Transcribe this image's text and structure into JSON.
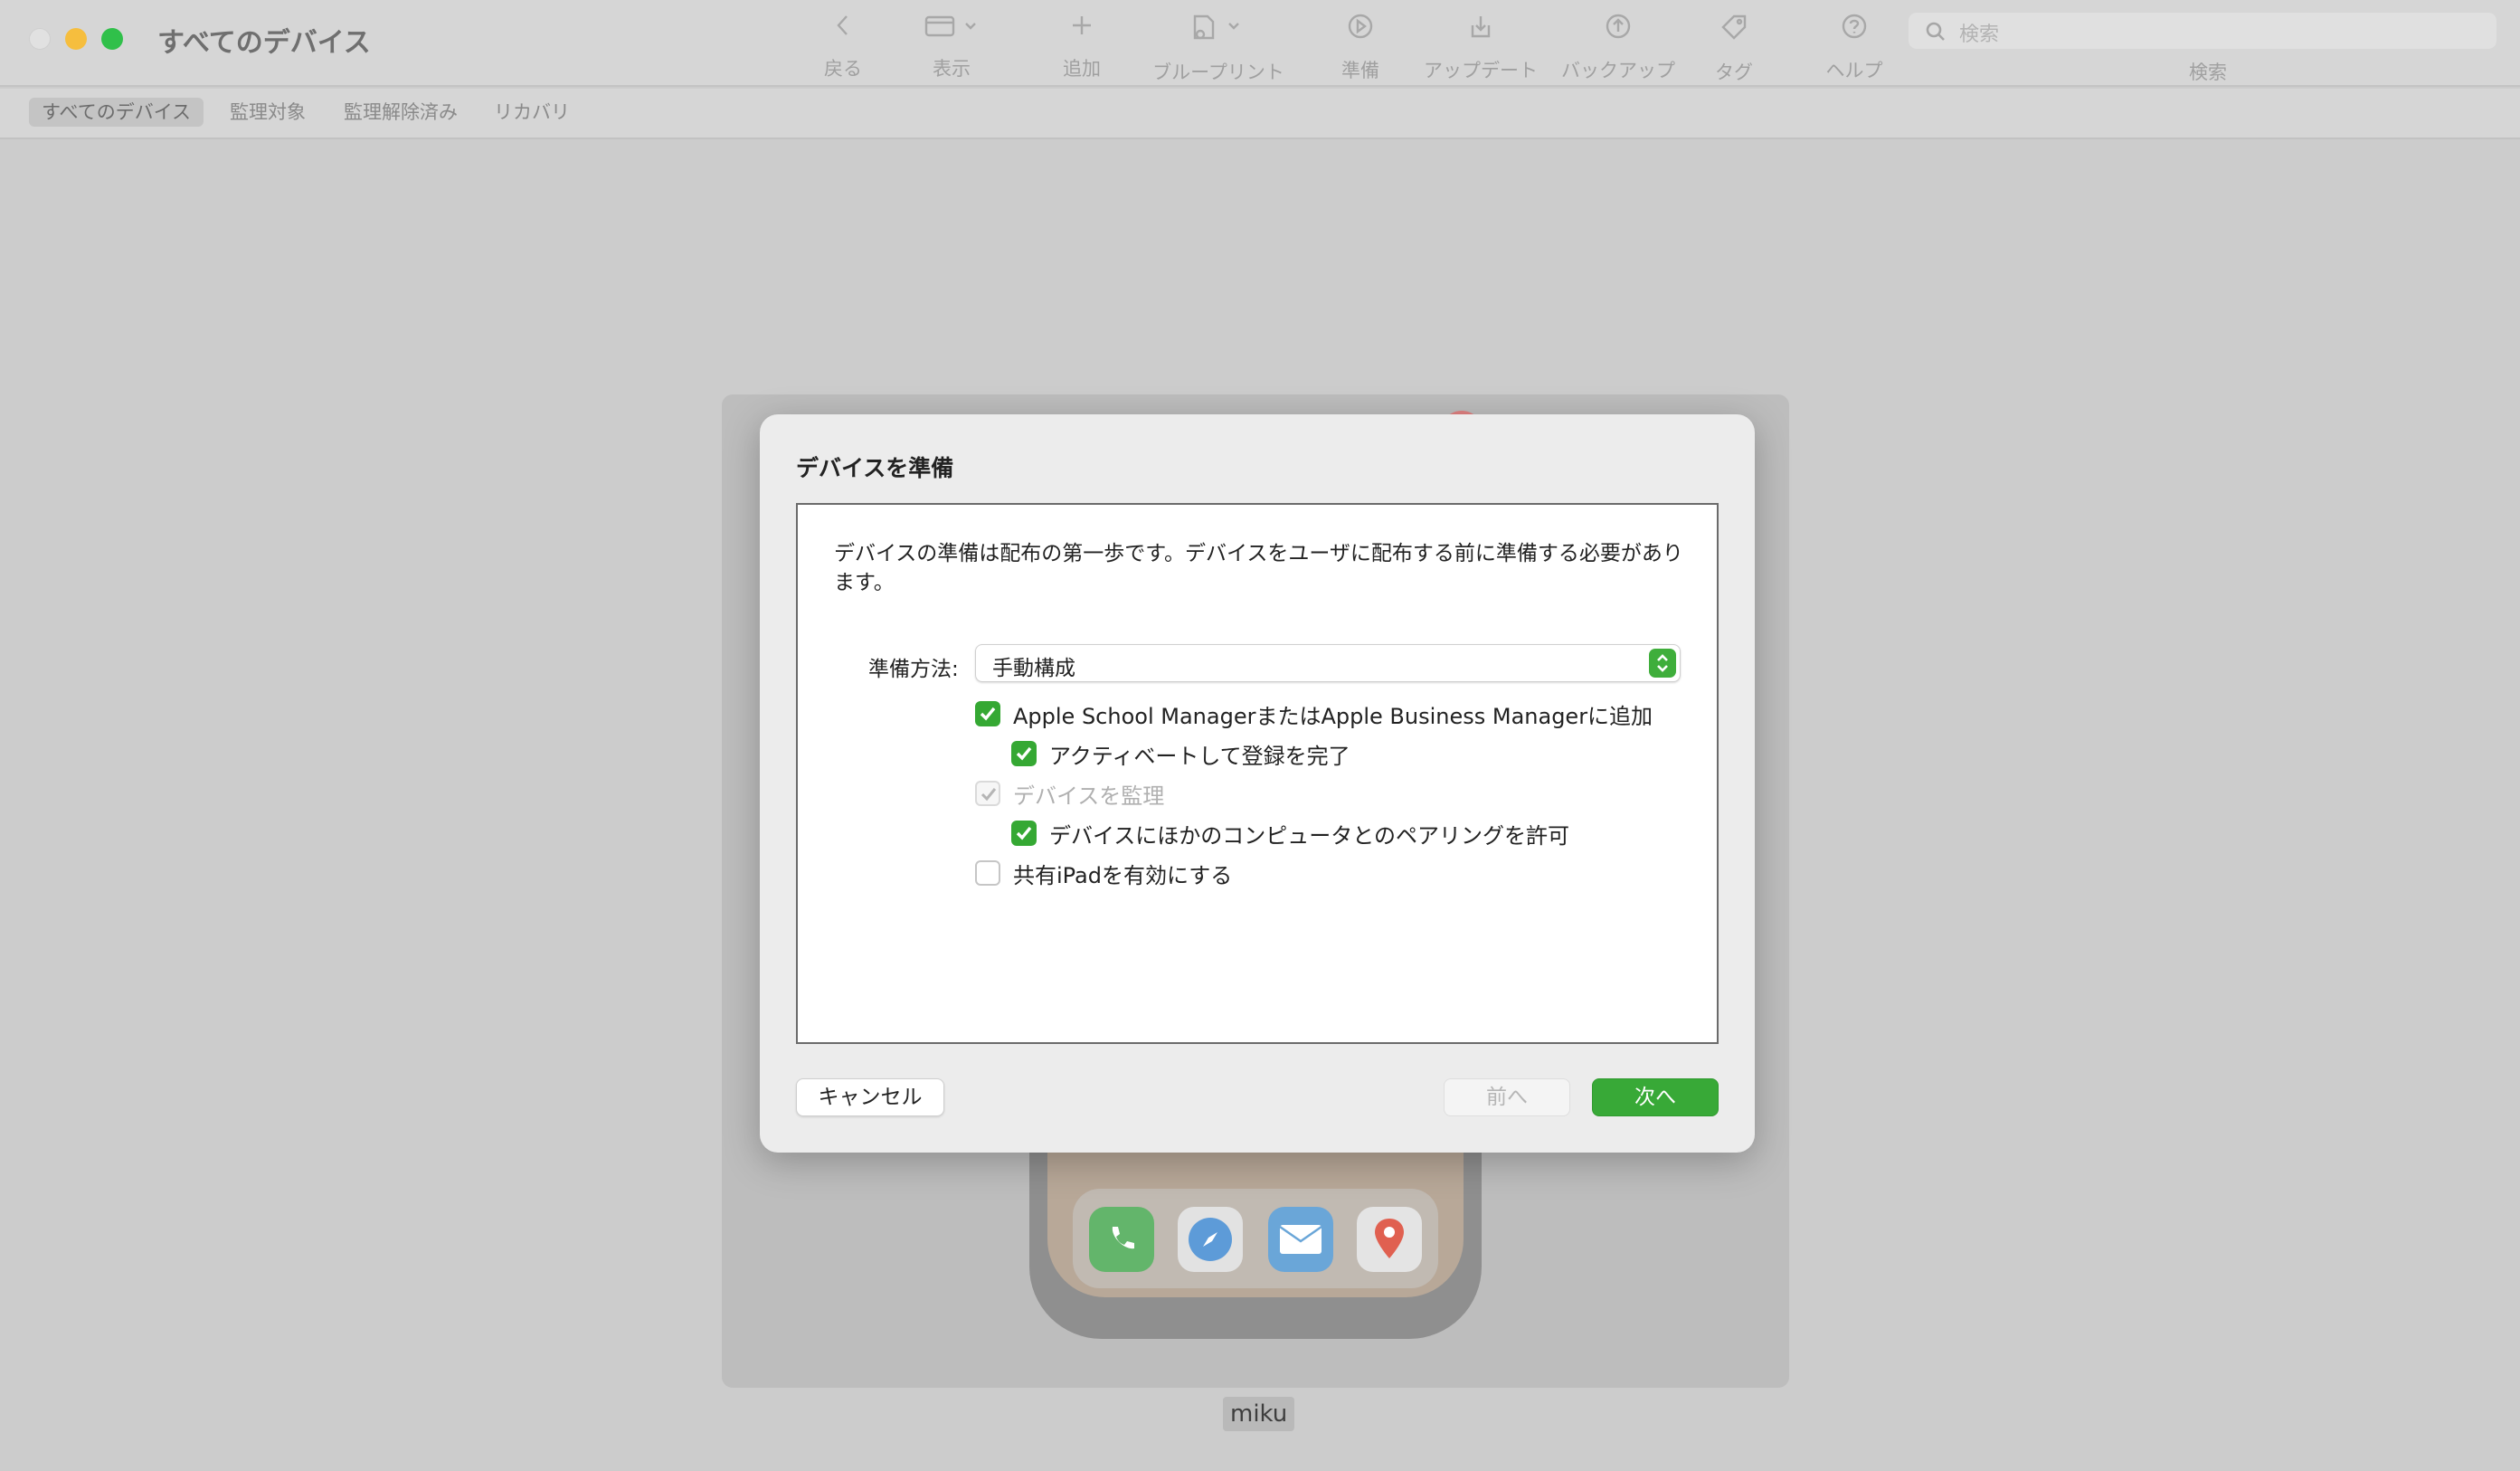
{
  "window": {
    "title": "すべてのデバイス"
  },
  "toolbar": {
    "items": [
      {
        "label": "戻る",
        "icon": "chevron-left-icon"
      },
      {
        "label": "表示",
        "icon": "window-view-icon"
      },
      {
        "label": "追加",
        "icon": "plus-icon"
      },
      {
        "label": "ブループリント",
        "icon": "blueprint-icon"
      },
      {
        "label": "準備",
        "icon": "play-circle-icon"
      },
      {
        "label": "アップデート",
        "icon": "download-tray-icon"
      },
      {
        "label": "バックアップ",
        "icon": "backup-circle-icon"
      },
      {
        "label": "タグ",
        "icon": "tag-icon"
      },
      {
        "label": "ヘルプ",
        "icon": "help-circle-icon"
      }
    ],
    "search_placeholder": "検索",
    "search_label": "検索"
  },
  "filters": {
    "items": [
      "すべてのデバイス",
      "監理対象",
      "監理解除済み",
      "リカバリ"
    ],
    "active_index": 0
  },
  "device": {
    "name": "miku",
    "dock_apps": [
      "phone-app-icon",
      "safari-app-icon",
      "mail-app-icon",
      "maps-app-icon"
    ]
  },
  "dialog": {
    "title": "デバイスを準備",
    "description": "デバイスの準備は配布の第一歩です。デバイスをユーザに配布する前に準備する必要があります。",
    "method_label": "準備方法:",
    "method_value": "手動構成",
    "options": [
      {
        "label": "Apple School ManagerまたはApple Business Managerに追加",
        "checked": true,
        "disabled": false,
        "indent": 0
      },
      {
        "label": "アクティベートして登録を完了",
        "checked": true,
        "disabled": false,
        "indent": 1
      },
      {
        "label": "デバイスを監理",
        "checked": true,
        "disabled": true,
        "indent": 0
      },
      {
        "label": "デバイスにほかのコンピュータとのペアリングを許可",
        "checked": true,
        "disabled": false,
        "indent": 1
      },
      {
        "label": "共有iPadを有効にする",
        "checked": false,
        "disabled": false,
        "indent": 0
      }
    ],
    "cancel_label": "キャンセル",
    "prev_label": "前へ",
    "next_label": "次へ"
  },
  "colors": {
    "accent": "#38a937",
    "titlebar": "#d6d6d6",
    "dim_background": "#cccccc"
  }
}
